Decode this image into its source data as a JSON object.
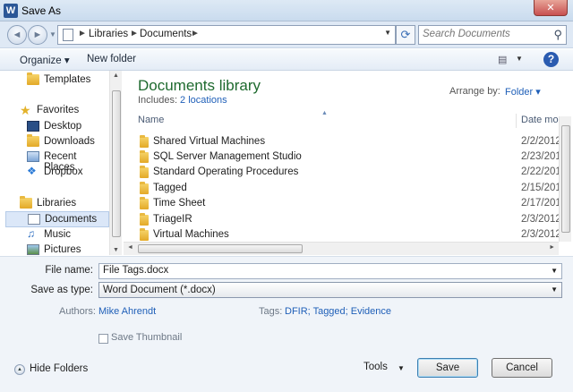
{
  "window": {
    "title": "Save As",
    "app_icon_letter": "W",
    "close_glyph": "✕"
  },
  "nav": {
    "back_glyph": "◄",
    "forward_glyph": "►",
    "breadcrumb": [
      "Libraries",
      "Documents"
    ],
    "search_placeholder": "Search Documents",
    "refresh_glyph": "⟳",
    "search_icon": "⚲"
  },
  "toolbar": {
    "organize_label": "Organize ▾",
    "new_folder_label": "New folder",
    "view_icon": "▤",
    "help_label": "?"
  },
  "sidebar": {
    "items": [
      {
        "label": "Templates",
        "icon": "folder-icon"
      },
      {
        "label": "Favorites",
        "icon": "star-icon"
      },
      {
        "label": "Desktop",
        "icon": "desktop-icon"
      },
      {
        "label": "Downloads",
        "icon": "downloads-icon"
      },
      {
        "label": "Recent Places",
        "icon": "recent-places-icon"
      },
      {
        "label": "Dropbox",
        "icon": "dropbox-icon"
      },
      {
        "label": "Libraries",
        "icon": "libraries-icon"
      },
      {
        "label": "Documents",
        "icon": "documents-icon",
        "selected": true
      },
      {
        "label": "Music",
        "icon": "music-icon"
      },
      {
        "label": "Pictures",
        "icon": "pictures-icon"
      }
    ]
  },
  "library": {
    "title": "Documents library",
    "includes_label": "Includes:",
    "includes_link": "2 locations",
    "arrange_label": "Arrange by:",
    "arrange_value": "Folder ▾"
  },
  "columns": {
    "name": "Name",
    "date": "Date mo"
  },
  "files": [
    {
      "name": "Shared Virtual Machines",
      "date": "2/2/2012"
    },
    {
      "name": "SQL Server Management Studio",
      "date": "2/23/201"
    },
    {
      "name": "Standard Operating Procedures",
      "date": "2/22/201"
    },
    {
      "name": "Tagged",
      "date": "2/15/201"
    },
    {
      "name": "Time Sheet",
      "date": "2/17/201"
    },
    {
      "name": "TriageIR",
      "date": "2/3/2012"
    },
    {
      "name": "Virtual Machines",
      "date": "2/3/2012"
    }
  ],
  "form": {
    "file_name_label": "File name:",
    "file_name_value": "File Tags.docx",
    "save_type_label": "Save as type:",
    "save_type_value": "Word Document (*.docx)",
    "authors_label": "Authors:",
    "authors_value": "Mike Ahrendt",
    "tags_label": "Tags:",
    "tags_value": "DFIR; Tagged; Evidence",
    "thumbnail_label": "Save Thumbnail",
    "thumbnail_checked": false
  },
  "footer": {
    "hide_folders_label": "Hide Folders",
    "tools_label": "Tools",
    "save_label": "Save",
    "cancel_label": "Cancel"
  },
  "colors": {
    "library_title": "#1e6a2e",
    "link": "#1f5fb8",
    "help_icon": "#2a5bb0"
  }
}
